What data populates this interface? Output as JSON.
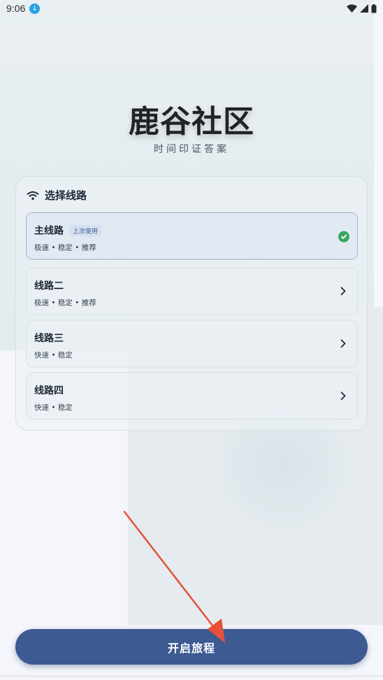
{
  "status_bar": {
    "time": "9:06",
    "download_icon": "download-icon",
    "icons": [
      "wifi-icon",
      "cell-signal-icon",
      "battery-icon"
    ]
  },
  "app": {
    "title": "鹿谷社区",
    "subtitle": "时间印证答案"
  },
  "route_select": {
    "header_icon": "wifi-icon",
    "header": "选择线路",
    "items": [
      {
        "name": "主线路",
        "tag": "上次使用",
        "desc": "极速 • 稳定 • 推荐",
        "selected": true
      },
      {
        "name": "线路二",
        "tag": "",
        "desc": "极速 • 稳定 • 推荐",
        "selected": false
      },
      {
        "name": "线路三",
        "tag": "",
        "desc": "快速 • 稳定",
        "selected": false
      },
      {
        "name": "线路四",
        "tag": "",
        "desc": "快速 • 稳定",
        "selected": false
      }
    ]
  },
  "actions": {
    "start_label": "开启旅程"
  },
  "colors": {
    "accent": "#3e5a93",
    "selected_check": "#38a85f",
    "annotation_arrow": "#e8503a"
  }
}
